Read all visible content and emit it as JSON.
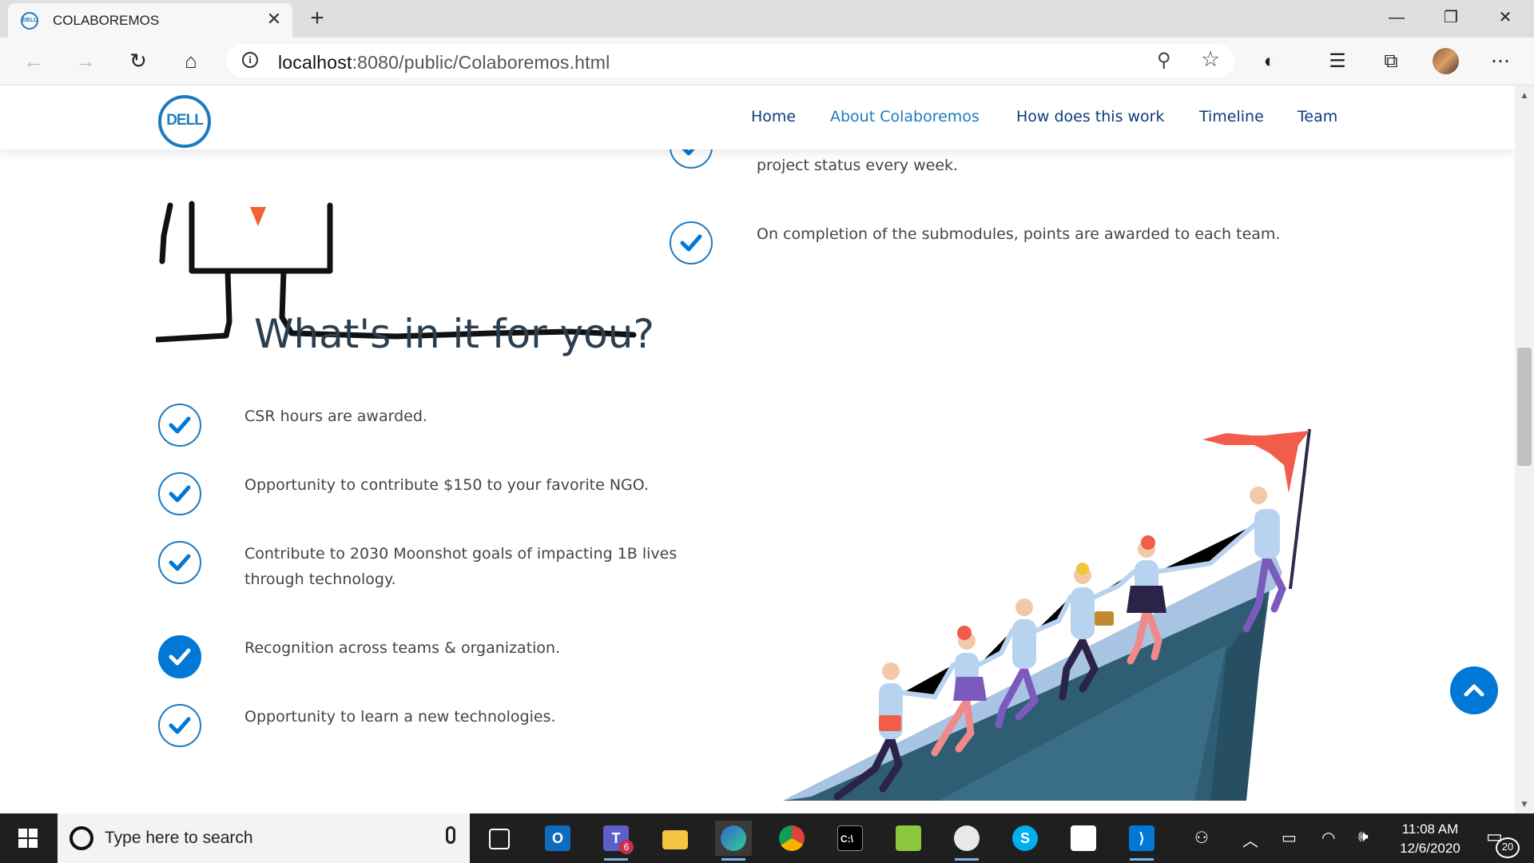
{
  "browser": {
    "tab_title": "COLABOREMOS",
    "tab_favicon_text": "DELL",
    "url_host": "localhost",
    "url_rest": ":8080/public/Colaboremos.html"
  },
  "nav": {
    "logo_text": "DELL",
    "links": [
      "Home",
      "About Colaboremos",
      "How does this work",
      "Timeline",
      "Team"
    ]
  },
  "process_items": [
    "project status every week.",
    "On completion of the submodules, points are awarded to each team."
  ],
  "benefits": {
    "heading": "What's in it for you?",
    "items": [
      "CSR hours are awarded.",
      "Opportunity to contribute $150 to your favorite NGO.",
      "Contribute to 2030 Moonshot goals of impacting 1B lives through technology.",
      "Recognition across teams & organization.",
      "Opportunity to learn a new technologies."
    ]
  },
  "taskbar": {
    "search_placeholder": "Type here to search",
    "time": "11:08 AM",
    "date": "12/6/2020",
    "notification_count": "20",
    "teams_badge": "6"
  },
  "colors": {
    "accent": "#1e7bbf",
    "nav_text": "#0b3c7a",
    "button_blue": "#0078d7",
    "flag": "#f25c4a"
  }
}
